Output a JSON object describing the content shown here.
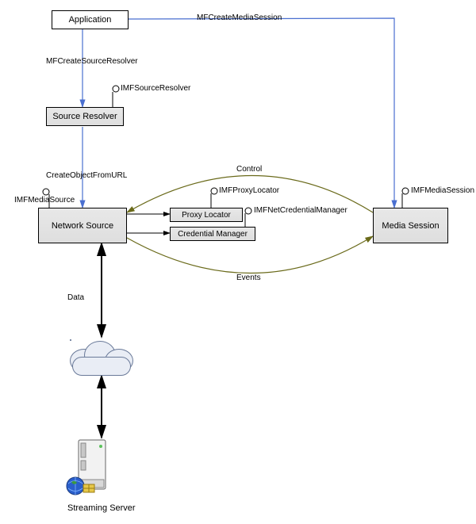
{
  "nodes": {
    "application": "Application",
    "sourceResolver": "Source Resolver",
    "networkSource": "Network Source",
    "proxyLocator": "Proxy Locator",
    "credentialManager": "Credential Manager",
    "mediaSession": "Media Session",
    "streamingServer": "Streaming Server"
  },
  "interfaces": {
    "sourceResolver": "IMFSourceResolver",
    "mediaSource": "IMFMediaSource",
    "proxyLocator": "IMFProxyLocator",
    "netCredentialManager": "IMFNetCredentialManager",
    "mediaSession": "IMFMediaSession"
  },
  "edges": {
    "createSourceResolver": "MFCreateSourceResolver",
    "createMediaSession": "MFCreateMediaSession",
    "createObjectFromURL": "CreateObjectFromURL",
    "control": "Control",
    "events": "Events",
    "data": "Data"
  }
}
